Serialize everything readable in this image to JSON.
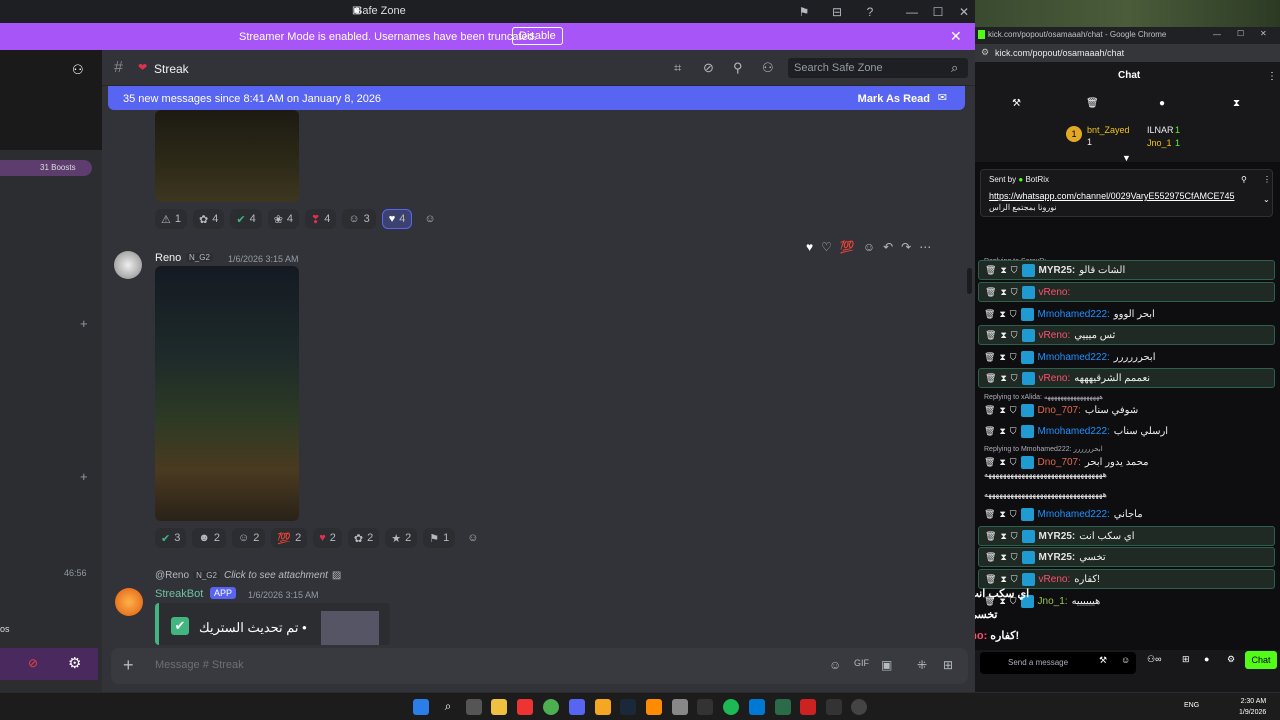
{
  "discord": {
    "window_title": "Safe Zone",
    "banner": {
      "text": "Streamer Mode is enabled. Usernames have been truncated.",
      "button": "Disable"
    },
    "sidebar": {
      "boosts": "31 Boosts",
      "time": "46:56",
      "partial": "os"
    },
    "header": {
      "channel": "Streak",
      "search_placeholder": "Search Safe Zone"
    },
    "new_messages": {
      "text": "35 new messages since 8:41 AM on January 8, 2026",
      "action": "Mark As Read"
    },
    "reactions_top": [
      "1",
      "4",
      "4",
      "4",
      "4",
      "3",
      "4"
    ],
    "message_reno": {
      "username": "Reno",
      "tag": "N_G2",
      "timestamp": "1/6/2026 3:15 AM"
    },
    "reactions_bottom": [
      "3",
      "2",
      "2",
      "2",
      "2",
      "2",
      "2",
      "1"
    ],
    "reply": {
      "user": "@Reno",
      "tag": "N_G2",
      "text": "Click to see attachment"
    },
    "message_bot": {
      "username": "StreakBot",
      "badge": "APP",
      "timestamp": "1/6/2026 3:15 AM",
      "embed_text": "تم تحديث الستريك •"
    },
    "composer": {
      "placeholder": "Message # Streak"
    }
  },
  "chrome": {
    "title": "kick.com/popout/osamaaah/chat - Google Chrome",
    "url": "kick.com/popout/osamaaah/chat",
    "chat_title": "Chat",
    "leaders": [
      {
        "rank": "1",
        "name": "bnt_Zayed",
        "count": "1"
      },
      {
        "name": "ILNAR",
        "count": "1"
      },
      {
        "name": "Jno_1",
        "count": "1"
      }
    ],
    "pinned": {
      "sent_by": "Sent by",
      "bot": "BotRix",
      "link": "https://whatsapp.com/channel/0029VaryE552975CfAMCE745",
      "sub": "نورونا بمجتمع الراس"
    },
    "messages": [
      {
        "reply": "Replying to SaraxR: رررررررررررر..."
      },
      {
        "user": "MYR25:",
        "text": "الشات قالو",
        "cls": "u-myr",
        "hl": true
      },
      {
        "user": "vReno:",
        "text": "",
        "cls": "u-reno",
        "hl": true
      },
      {
        "user": "Mmohamed222:",
        "text": "ابحر الووو",
        "cls": "u-mm",
        "hl": false
      },
      {
        "user": "vReno:",
        "text": "ثس ميييي",
        "cls": "u-reno",
        "hl": true
      },
      {
        "user": "Mmohamed222:",
        "text": "ابحرررررر",
        "cls": "u-mm",
        "hl": false
      },
      {
        "user": "vReno:",
        "text": "نعممم الشرقيهههه",
        "cls": "u-reno",
        "hl": true
      },
      {
        "reply": "Replying to xAlida: هههههههههههههههههه"
      },
      {
        "user": "Dno_707:",
        "text": "شوفي سناب",
        "cls": "u-dno",
        "hl": false
      },
      {
        "user": "Mmohamed222:",
        "text": "ارسلي سناب",
        "cls": "u-mm",
        "hl": false
      },
      {
        "reply": "Replying to Mmohamed222: ابحرررررر"
      },
      {
        "user": "Dno_707:",
        "text": "محمد يدور ابحر",
        "cls": "u-dno",
        "hl": false
      },
      {
        "plain": "ههههههههههههههههههههههههههههههههه"
      },
      {
        "plain": "ههههههههههههههههههههههههههههههههه"
      },
      {
        "user": "Mmohamed222:",
        "text": "ماجاني",
        "cls": "u-mm",
        "hl": false
      },
      {
        "user": "MYR25:",
        "text": "اي سكب انت",
        "cls": "u-myr",
        "hl": true
      },
      {
        "user": "MYR25:",
        "text": "تخسي",
        "cls": "u-myr",
        "hl": true
      },
      {
        "user": "vReno:",
        "text": "كفاره!",
        "cls": "u-reno",
        "hl": true
      },
      {
        "user": "Jno_1:",
        "text": "هييييييه",
        "cls": "u-jno",
        "hl": false
      }
    ],
    "overlay": [
      {
        "user": "MYR25:",
        "text": "اي سكب انت"
      },
      {
        "user": "MYR25:",
        "text": "تخسي"
      },
      {
        "user": "vReno:",
        "text": "كفاره!"
      }
    ],
    "input_placeholder": "Send a message",
    "chat_button": "Chat"
  },
  "taskbar": {
    "time": "2:30 AM",
    "date": "1/9/2026",
    "lang": "ENG"
  },
  "colors": {
    "discord_bg": "#313338",
    "banner": "#a855f7",
    "blurple": "#5865f2",
    "kick_green": "#53fc18"
  }
}
